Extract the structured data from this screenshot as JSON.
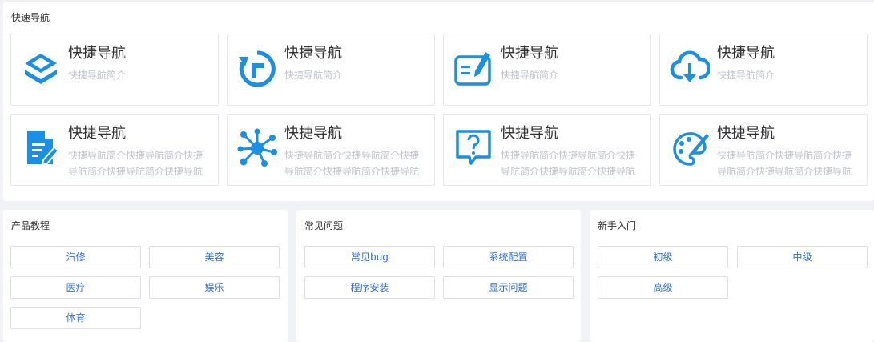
{
  "quick_nav": {
    "title": "快速导航",
    "cards": [
      {
        "icon": "layers-icon",
        "title": "快捷导航",
        "desc": "快捷导航简介"
      },
      {
        "icon": "refresh-icon",
        "title": "快捷导航",
        "desc": "快捷导航简介"
      },
      {
        "icon": "edit-board-icon",
        "title": "快捷导航",
        "desc": "快捷导航简介"
      },
      {
        "icon": "cloud-download-icon",
        "title": "快捷导航",
        "desc": "快捷导航简介"
      },
      {
        "icon": "document-edit-icon",
        "title": "快捷导航",
        "desc": "快捷导航简介快捷导航简介快捷导航简介快捷导航简介快捷导航简介"
      },
      {
        "icon": "network-icon",
        "title": "快捷导航",
        "desc": "快捷导航简介快捷导航简介快捷导航简介快捷导航简介快捷导航简介快捷"
      },
      {
        "icon": "help-message-icon",
        "title": "快捷导航",
        "desc": "快捷导航简介快捷导航简介快捷导航简介快捷导航简介快捷导航简介快捷"
      },
      {
        "icon": "palette-icon",
        "title": "快捷导航",
        "desc": "快捷导航简介快捷导航简介快捷导航简介快捷导航简介快捷导航简介"
      }
    ]
  },
  "panels": [
    {
      "title": "产品教程",
      "links": [
        "汽修",
        "美容",
        "医疗",
        "娱乐",
        "体育"
      ]
    },
    {
      "title": "常见问题",
      "links": [
        "常见bug",
        "系统配置",
        "程序安装",
        "显示问题"
      ]
    },
    {
      "title": "新手入门",
      "links": [
        "初级",
        "中级",
        "高级"
      ]
    }
  ],
  "colors": {
    "accent": "#1a8fe3",
    "link": "#2f6bdc",
    "muted": "#c0c4cc"
  }
}
